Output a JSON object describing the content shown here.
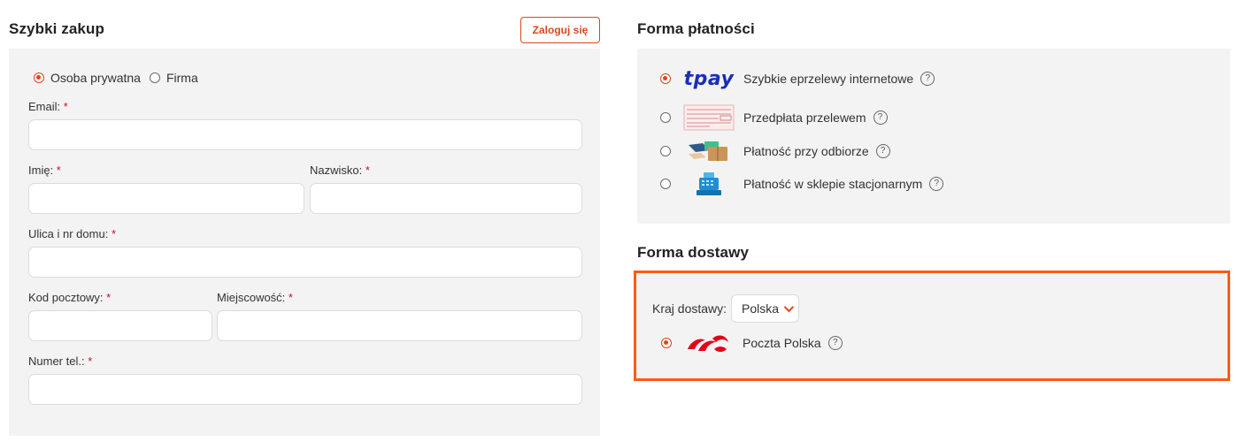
{
  "checkout": {
    "title": "Szybki zakup",
    "login_label": "Zaloguj się",
    "customer_type": {
      "private_label": "Osoba prywatna",
      "company_label": "Firma",
      "selected": "private"
    },
    "required_mark": "*",
    "fields": {
      "email": {
        "label": "Email:",
        "value": ""
      },
      "first_name": {
        "label": "Imię:",
        "value": ""
      },
      "last_name": {
        "label": "Nazwisko:",
        "value": ""
      },
      "street": {
        "label": "Ulica i nr domu:",
        "value": ""
      },
      "postal_code": {
        "label": "Kod pocztowy:",
        "value": ""
      },
      "city": {
        "label": "Miejscowość:",
        "value": ""
      },
      "phone": {
        "label": "Numer tel.:",
        "value": ""
      }
    }
  },
  "payment": {
    "title": "Forma płatności",
    "help_glyph": "?",
    "options": [
      {
        "logo_text": "tpay",
        "label": "Szybkie eprzelewy internetowe",
        "selected": true,
        "icon": "tpay-logo"
      },
      {
        "label": "Przedpłata przelewem",
        "selected": false,
        "icon": "bank-transfer-form-icon"
      },
      {
        "label": "Płatność przy odbiorze",
        "selected": false,
        "icon": "cash-on-delivery-icon"
      },
      {
        "label": "Płatność w sklepie stacjonarnym",
        "selected": false,
        "icon": "cash-register-icon"
      }
    ]
  },
  "shipping": {
    "title": "Forma dostawy",
    "country_label": "Kraj dostawy:",
    "country_value": "Polska",
    "options": [
      {
        "label": "Poczta Polska",
        "selected": true,
        "icon": "poczta-polska-logo"
      }
    ]
  },
  "colors": {
    "accent": "#d9481c",
    "highlight_border": "#ff5a14",
    "panel_bg": "#f3f3f3",
    "required": "#c8102e",
    "tpay_blue": "#1a2fb5"
  }
}
